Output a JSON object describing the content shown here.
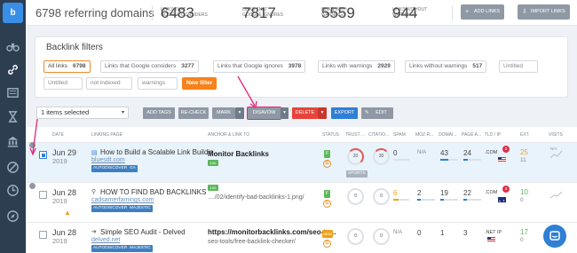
{
  "app": {
    "logo_text": "b"
  },
  "nav": {
    "icons": [
      "binoculars-icon",
      "link-icon",
      "newspaper-icon",
      "hourglass-icon",
      "bank-icon",
      "compass-slash-icon",
      "clock-icon",
      "compass-icon"
    ]
  },
  "header": {
    "title": "6798 referring domains",
    "stats": [
      {
        "value": "6483",
        "label_1": "LINKS THAT",
        "label_2": "GOOGLE CONSIDERS"
      },
      {
        "value": "7817",
        "label_1": "LINKS THAT",
        "label_2": "GOOGLE IGNORES"
      },
      {
        "value": "5559",
        "label_1": "LINKS WITH",
        "label_2": "WARNINGS"
      },
      {
        "value": "944",
        "label_1": "LINKS WITHOUT",
        "label_2": "WARNINGS"
      }
    ],
    "add_links": "ADD LINKS",
    "import_links": "IMPORT LINKS"
  },
  "filters": {
    "title": "Backlink filters",
    "chips": [
      {
        "label": "All links",
        "count": "6798"
      },
      {
        "label": "Links that Google considers",
        "count": "3277"
      },
      {
        "label": "Links that Google ignores",
        "count": "3978"
      },
      {
        "label": "Links with warnings",
        "count": "2929"
      },
      {
        "label": "Links without warnings",
        "count": "517"
      }
    ],
    "inputs": [
      "Untitled",
      "Untitled",
      "not indexed",
      "warnings"
    ],
    "new_filter": "New filter"
  },
  "toolbar": {
    "selected": "1 items selected",
    "add_tags": "ADD TAGS",
    "recheck": "RE-CHECK",
    "mark": "MARK",
    "disavow": "DISAVOW",
    "delete": "DELETE",
    "export": "EXPORT",
    "edit": "EDIT"
  },
  "table": {
    "headers": [
      "DATE",
      "LINKING PAGE",
      "ANCHOR & LINK TO",
      "STATUS",
      "TRUST ...",
      "CITATIO...",
      "SPAM",
      "MOZ R...",
      "DOMAI...",
      "PAGE A...",
      "TLD / IP",
      "EXT.",
      "VISITS"
    ],
    "rows": [
      {
        "date": "Jun 29",
        "year": "2019",
        "title": "How to Build a Scalable Link Buildin...",
        "url": "bluesdt.com",
        "tags": [
          "AUTODISCOVER",
          "GA"
        ],
        "anchor": "Monitor Backlinks",
        "anchor_sub": "",
        "anchor_tag": "100",
        "status_box": "F",
        "status_letter": "G",
        "trust": "20",
        "citation": "30",
        "sports": "SPORTS",
        "spam": "0",
        "moz": "N/A",
        "domain": "43",
        "page": "24",
        "tld": ".COM",
        "tld_badge": "2",
        "ext": "25",
        "ext_sub": "11"
      },
      {
        "date": "Jun 28",
        "year": "2019",
        "title": "HOW TO FIND BAD BACKLINKS",
        "url": "cadsamerfamings.com",
        "tags": [
          "AUTODISCOVER",
          "MAJESTIC"
        ],
        "anchor": "",
        "anchor_sub": "..../02/identify-bad-backlinks-1.png/",
        "anchor_tag": "100",
        "status_box": "F",
        "status_letter": "G",
        "trust": "0",
        "citation": "0",
        "spam": "6",
        "moz": "2",
        "domain": "19",
        "page": "22",
        "tld": ".COM",
        "tld_badge": "4",
        "ext": "10",
        "ext_sub": "0"
      },
      {
        "date": "Jun 28",
        "year": "2019",
        "title": "Simple SEO Audit - Delved",
        "url": "delved.net",
        "tags": [
          "AUTODISCOVER",
          "MAJESTIC"
        ],
        "anchor": "https://monitorbacklinks.com/seo-to...",
        "anchor_sub": "seo-tools/free-backlink-checker/",
        "anchor_tag": "100",
        "status_box": "NEW",
        "status_letter": "G",
        "trust": "0",
        "citation": "0",
        "spam": "N/A",
        "moz": "0",
        "domain": "1",
        "page": "3",
        "tld": ".NET IP",
        "tld_badge": "",
        "ext": "17",
        "ext_sub": "0"
      }
    ]
  },
  "colors": {
    "accent": "#2f7fd4",
    "orange": "#f7821b",
    "red": "#e8443a",
    "nav": "#2c3e50"
  }
}
